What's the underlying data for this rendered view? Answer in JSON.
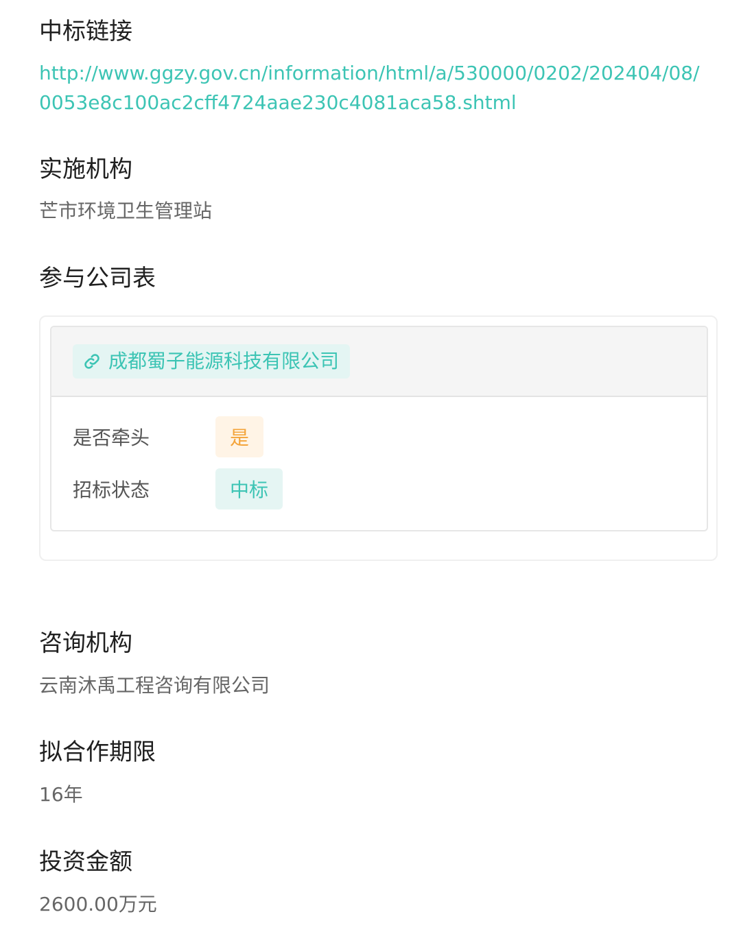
{
  "bid_link": {
    "label": "中标链接",
    "url": "http://www.ggzy.gov.cn/information/html/a/530000/0202/202404/08/0053e8c100ac2cff4724aae230c4081aca58.shtml"
  },
  "implementing_agency": {
    "label": "实施机构",
    "value": "芒市环境卫生管理站"
  },
  "participants": {
    "label": "参与公司表",
    "companies": [
      {
        "name": "成都蜀子能源科技有限公司",
        "icon": "link-icon",
        "is_lead_label": "是否牵头",
        "is_lead_value": "是",
        "bid_status_label": "招标状态",
        "bid_status_value": "中标"
      }
    ]
  },
  "consulting_agency": {
    "label": "咨询机构",
    "value": "云南沐禹工程咨询有限公司"
  },
  "cooperation_period": {
    "label": "拟合作期限",
    "value": "16年"
  },
  "investment_amount": {
    "label": "投资金额",
    "value": "2600.00万元"
  },
  "colors": {
    "accent": "#3cc4b4",
    "accent_bg": "#e4f5f3",
    "orange": "#f4a43a",
    "orange_bg": "#fff4e6"
  }
}
